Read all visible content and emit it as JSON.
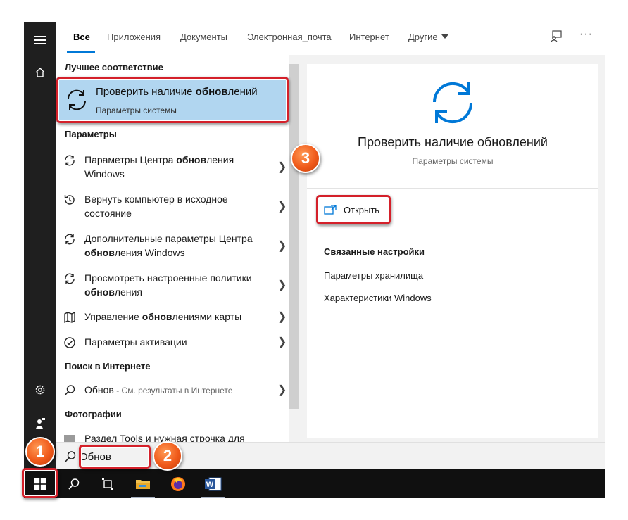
{
  "tabs": [
    {
      "label": "Все",
      "active": true
    },
    {
      "label": "Приложения"
    },
    {
      "label": "Документы"
    },
    {
      "label": "Электронная_почта"
    },
    {
      "label": "Интернет"
    },
    {
      "label": "Другие"
    }
  ],
  "best_match": {
    "heading": "Лучшее соответствие",
    "title_pre": "Проверить наличие ",
    "title_bold": "обнов",
    "title_post": "лений",
    "subtitle": "Параметры системы",
    "icon": "refresh-icon"
  },
  "settings_section": {
    "heading": "Параметры",
    "items": [
      {
        "pre": "Параметры Центра ",
        "bold": "обнов",
        "post": "ления Windows",
        "icon": "refresh-icon"
      },
      {
        "pre": "Вернуть компьютер в исходное состояние",
        "bold": "",
        "post": "",
        "icon": "history-icon"
      },
      {
        "pre": "Дополнительные параметры Центра ",
        "bold": "обнов",
        "post": "ления Windows",
        "icon": "refresh-icon"
      },
      {
        "pre": "Просмотреть настроенные политики ",
        "bold": "обнов",
        "post": "ления",
        "icon": "refresh-icon"
      },
      {
        "pre": "Управление ",
        "bold": "обнов",
        "post": "лениями карты",
        "icon": "map-icon"
      },
      {
        "pre": "Параметры активации",
        "bold": "",
        "post": "",
        "icon": "check-circle-icon"
      }
    ]
  },
  "web_section": {
    "heading": "Поиск в Интернете",
    "query": "Обнов",
    "hint": " - См. результаты в Интернете",
    "icon": "search-icon"
  },
  "photos_section": {
    "heading": "Фотографии",
    "item": "Раздел Tools и нужная строчка для"
  },
  "detail": {
    "title": "Проверить наличие обновлений",
    "subtitle": "Параметры системы",
    "open_label": "Открыть",
    "related_heading": "Связанные настройки",
    "related_links": [
      "Параметры хранилища",
      "Характеристики Windows"
    ]
  },
  "search": {
    "value": "Обнов"
  },
  "badges": [
    "1",
    "2",
    "3"
  ],
  "colors": {
    "accent": "#0078d7",
    "highlight": "#b1d6f0",
    "annotation_red": "#d4202a",
    "badge_orange": "#f05a1a",
    "rail": "#1f1f1f",
    "taskbar": "#101010"
  }
}
